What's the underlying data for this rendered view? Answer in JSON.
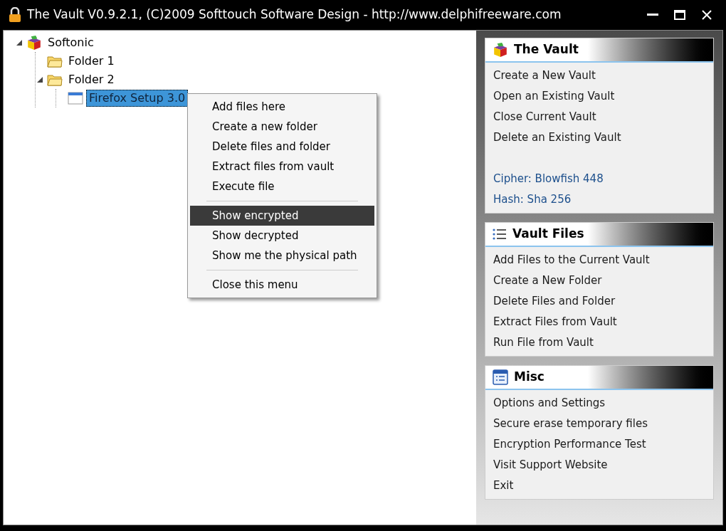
{
  "window": {
    "title": "The Vault V0.9.2.1, (C)2009 Softtouch Software Design - http://www.delphifreeware.com"
  },
  "tree": [
    {
      "label": "Softonic",
      "kind": "vault",
      "expanded": true,
      "selected": false,
      "children": [
        {
          "label": "Folder 1",
          "kind": "folder",
          "selected": false
        },
        {
          "label": "Folder 2",
          "kind": "folder",
          "expanded": true,
          "selected": false,
          "children": [
            {
              "label": "Firefox Setup 3.0",
              "kind": "file",
              "selected": true
            }
          ]
        }
      ]
    }
  ],
  "context_menu": {
    "groups": [
      [
        {
          "label": "Add files here",
          "selected": false
        },
        {
          "label": "Create a new folder",
          "selected": false
        },
        {
          "label": "Delete files and folder",
          "selected": false
        },
        {
          "label": "Extract files from vault",
          "selected": false
        },
        {
          "label": "Execute file",
          "selected": false
        }
      ],
      [
        {
          "label": "Show encrypted",
          "selected": true
        },
        {
          "label": "Show decrypted",
          "selected": false
        },
        {
          "label": "Show me the physical path",
          "selected": false
        }
      ],
      [
        {
          "label": "Close this menu",
          "selected": false
        }
      ]
    ]
  },
  "panels": [
    {
      "title": "The Vault",
      "kind": "vault",
      "items": [
        {
          "label": "Create a New Vault",
          "kind": "action"
        },
        {
          "label": "Open an Existing Vault",
          "kind": "action"
        },
        {
          "label": "Close Current Vault",
          "kind": "action"
        },
        {
          "label": "Delete an Existing Vault",
          "kind": "action"
        },
        {
          "label": "Cipher: Blowfish 448",
          "kind": "info"
        },
        {
          "label": "Hash: Sha 256",
          "kind": "info"
        }
      ]
    },
    {
      "title": "Vault Files",
      "kind": "list",
      "items": [
        {
          "label": "Add Files to the Current Vault",
          "kind": "action"
        },
        {
          "label": "Create a New Folder",
          "kind": "action"
        },
        {
          "label": "Delete Files and Folder",
          "kind": "action"
        },
        {
          "label": "Extract Files from Vault",
          "kind": "action"
        },
        {
          "label": "Run File from Vault",
          "kind": "action"
        }
      ]
    },
    {
      "title": "Misc",
      "kind": "form",
      "items": [
        {
          "label": "Options and Settings",
          "kind": "action"
        },
        {
          "label": "Secure erase temporary files",
          "kind": "action"
        },
        {
          "label": "Encryption Performance Test",
          "kind": "action"
        },
        {
          "label": "Visit Support Website",
          "kind": "action"
        },
        {
          "label": "Exit",
          "kind": "action"
        }
      ]
    }
  ]
}
